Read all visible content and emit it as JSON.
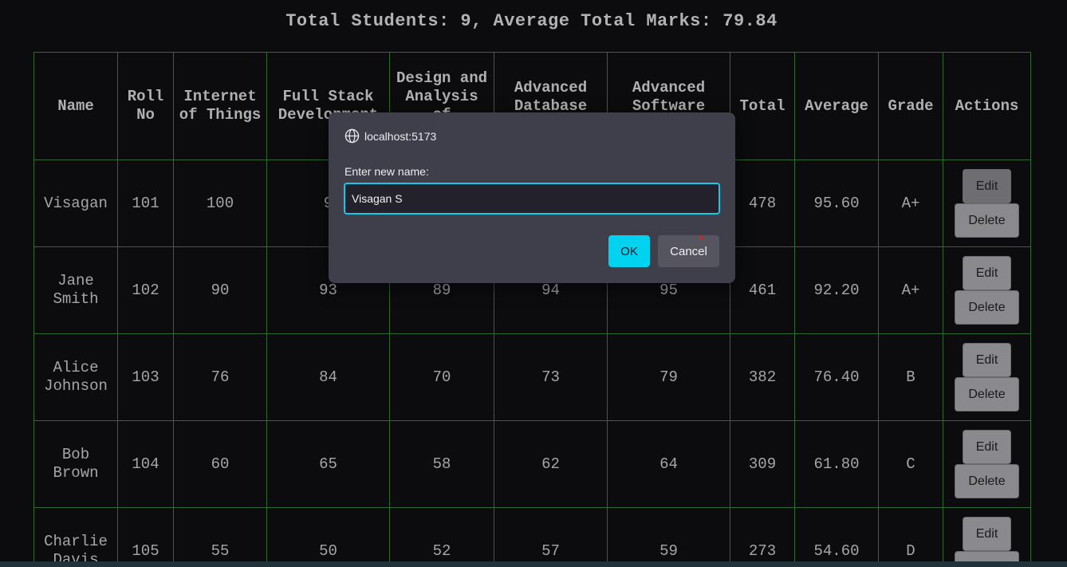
{
  "summary": {
    "text": "Total Students: 9, Average Total Marks: 79.84"
  },
  "table": {
    "headers": [
      {
        "key": "name",
        "label": "Name"
      },
      {
        "key": "roll",
        "label": "Roll No"
      },
      {
        "key": "iot",
        "label": "Internet of Things"
      },
      {
        "key": "fsd",
        "label": "Full Stack Development"
      },
      {
        "key": "daa",
        "label": "Design and Analysis of Algorithms"
      },
      {
        "key": "adbms",
        "label": "Advanced Database Management"
      },
      {
        "key": "ase",
        "label": "Advanced Software Engineering"
      },
      {
        "key": "total",
        "label": "Total"
      },
      {
        "key": "average",
        "label": "Average"
      },
      {
        "key": "grade",
        "label": "Grade"
      },
      {
        "key": "actions",
        "label": "Actions"
      }
    ],
    "rows": [
      {
        "name": "Visagan",
        "roll": "101",
        "iot": "100",
        "fsd": "9",
        "daa": "",
        "adbms": "",
        "ase": "",
        "total": "478",
        "average": "95.60",
        "grade": "A+"
      },
      {
        "name": "Jane Smith",
        "roll": "102",
        "iot": "90",
        "fsd": "93",
        "daa": "89",
        "adbms": "94",
        "ase": "95",
        "total": "461",
        "average": "92.20",
        "grade": "A+"
      },
      {
        "name": "Alice Johnson",
        "roll": "103",
        "iot": "76",
        "fsd": "84",
        "daa": "70",
        "adbms": "73",
        "ase": "79",
        "total": "382",
        "average": "76.40",
        "grade": "B"
      },
      {
        "name": "Bob Brown",
        "roll": "104",
        "iot": "60",
        "fsd": "65",
        "daa": "58",
        "adbms": "62",
        "ase": "64",
        "total": "309",
        "average": "61.80",
        "grade": "C"
      },
      {
        "name": "Charlie Davis",
        "roll": "105",
        "iot": "55",
        "fsd": "50",
        "daa": "52",
        "adbms": "57",
        "ase": "59",
        "total": "273",
        "average": "54.60",
        "grade": "D"
      }
    ],
    "edit_label": "Edit",
    "delete_label": "Delete"
  },
  "dialog": {
    "origin": "localhost:5173",
    "origin_icon": "globe-icon",
    "label": "Enter new name:",
    "input_value": "Visagan S",
    "ok_label": "OK",
    "cancel_label": "Cancel"
  },
  "colors": {
    "background": "#0c0c0e",
    "table_border": "#2f6a32",
    "dialog_bg": "#3f3e4b",
    "accent": "#00d2f0"
  }
}
